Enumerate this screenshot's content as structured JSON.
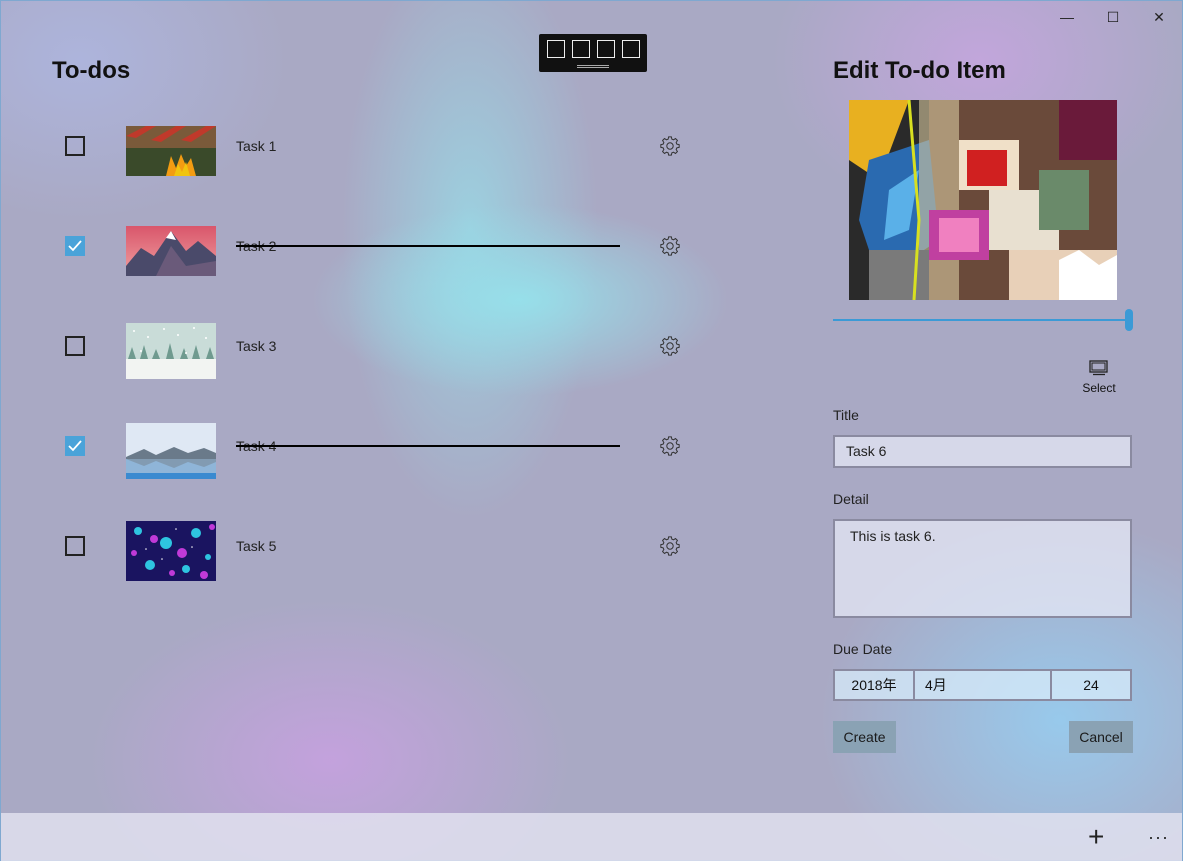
{
  "window": {
    "minimize": "—",
    "maximize": "☐",
    "close": "✕"
  },
  "left": {
    "title": "To-dos",
    "items": [
      {
        "label": "Task 1",
        "checked": false
      },
      {
        "label": "Task 2",
        "checked": true
      },
      {
        "label": "Task 3",
        "checked": false
      },
      {
        "label": "Task 4",
        "checked": true
      },
      {
        "label": "Task 5",
        "checked": false
      }
    ]
  },
  "right": {
    "title": "Edit To-do Item",
    "select_label": "Select",
    "title_label": "Title",
    "title_value": "Task 6",
    "detail_label": "Detail",
    "detail_value": "This is task 6.",
    "due_label": "Due Date",
    "due_year": "2018年",
    "due_month": "4月",
    "due_day": "24",
    "create_label": "Create",
    "cancel_label": "Cancel"
  },
  "commandbar": {
    "add": "+",
    "more": "···"
  },
  "colors": {
    "accent": "#3b9ad6",
    "check": "#4aa3d9",
    "button": "#8aa2b4"
  },
  "icons": [
    "gear-icon",
    "checkmark-icon",
    "select-icon",
    "add-icon",
    "more-icon",
    "chevron-icon"
  ]
}
